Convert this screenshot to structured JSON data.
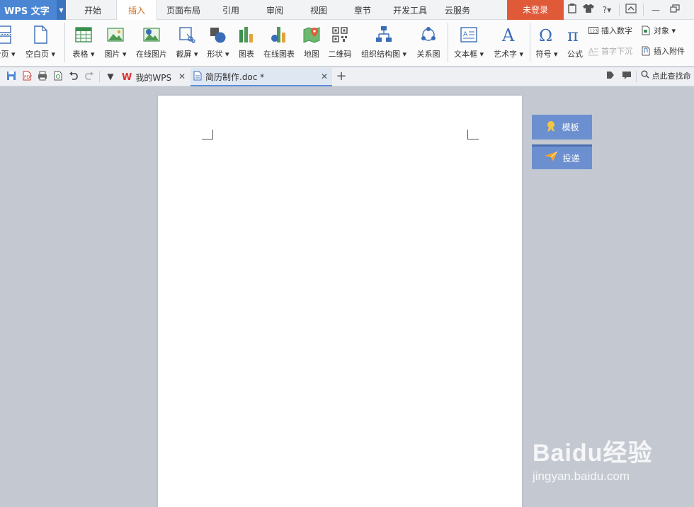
{
  "app": {
    "title": "WPS 文字"
  },
  "menu": {
    "tabs": [
      "开始",
      "插入",
      "页面布局",
      "引用",
      "审阅",
      "视图",
      "章节",
      "开发工具",
      "云服务"
    ],
    "active_tab": "插入",
    "login_label": "未登录"
  },
  "ribbon": {
    "buttons": [
      {
        "label": "分页 ▾",
        "icon": "page-break-icon"
      },
      {
        "label": "空白页 ▾",
        "icon": "blank-page-icon"
      },
      {
        "label": "表格 ▾",
        "icon": "table-icon"
      },
      {
        "label": "图片 ▾",
        "icon": "picture-icon"
      },
      {
        "label": "在线图片",
        "icon": "online-picture-icon"
      },
      {
        "label": "截屏 ▾",
        "icon": "screenshot-icon"
      },
      {
        "label": "形状 ▾",
        "icon": "shapes-icon"
      },
      {
        "label": "图表",
        "icon": "chart-icon"
      },
      {
        "label": "在线图表",
        "icon": "online-chart-icon"
      },
      {
        "label": "地图",
        "icon": "map-icon"
      },
      {
        "label": "二维码",
        "icon": "qrcode-icon"
      },
      {
        "label": "组织结构图 ▾",
        "icon": "org-chart-icon"
      },
      {
        "label": "关系图",
        "icon": "relation-chart-icon"
      },
      {
        "label": "文本框 ▾",
        "icon": "textbox-icon"
      },
      {
        "label": "艺术字 ▾",
        "icon": "wordart-icon"
      },
      {
        "label": "符号 ▾",
        "icon": "symbol-icon"
      },
      {
        "label": "公式",
        "icon": "formula-icon"
      }
    ],
    "small_buttons": {
      "insert_number": "插入数字",
      "object": "对象 ▾",
      "drop_cap": "首字下沉",
      "insert_attachment": "插入附件"
    }
  },
  "tabs": {
    "home_tab": "我的WPS",
    "doc_tab": "简历制作.doc *",
    "find_label": "点此查找命"
  },
  "side_panel": {
    "template_label": "模板",
    "deliver_label": "投递"
  },
  "watermark": {
    "logo_text": "Baidu经验",
    "url": "jingyan.baidu.com"
  },
  "colors": {
    "app_blue": "#4a86d4",
    "login_red": "#e05a3a",
    "active_tab_text": "#d2691e",
    "side_button": "#6c8fcf",
    "workspace_bg": "#c4c9d1"
  }
}
